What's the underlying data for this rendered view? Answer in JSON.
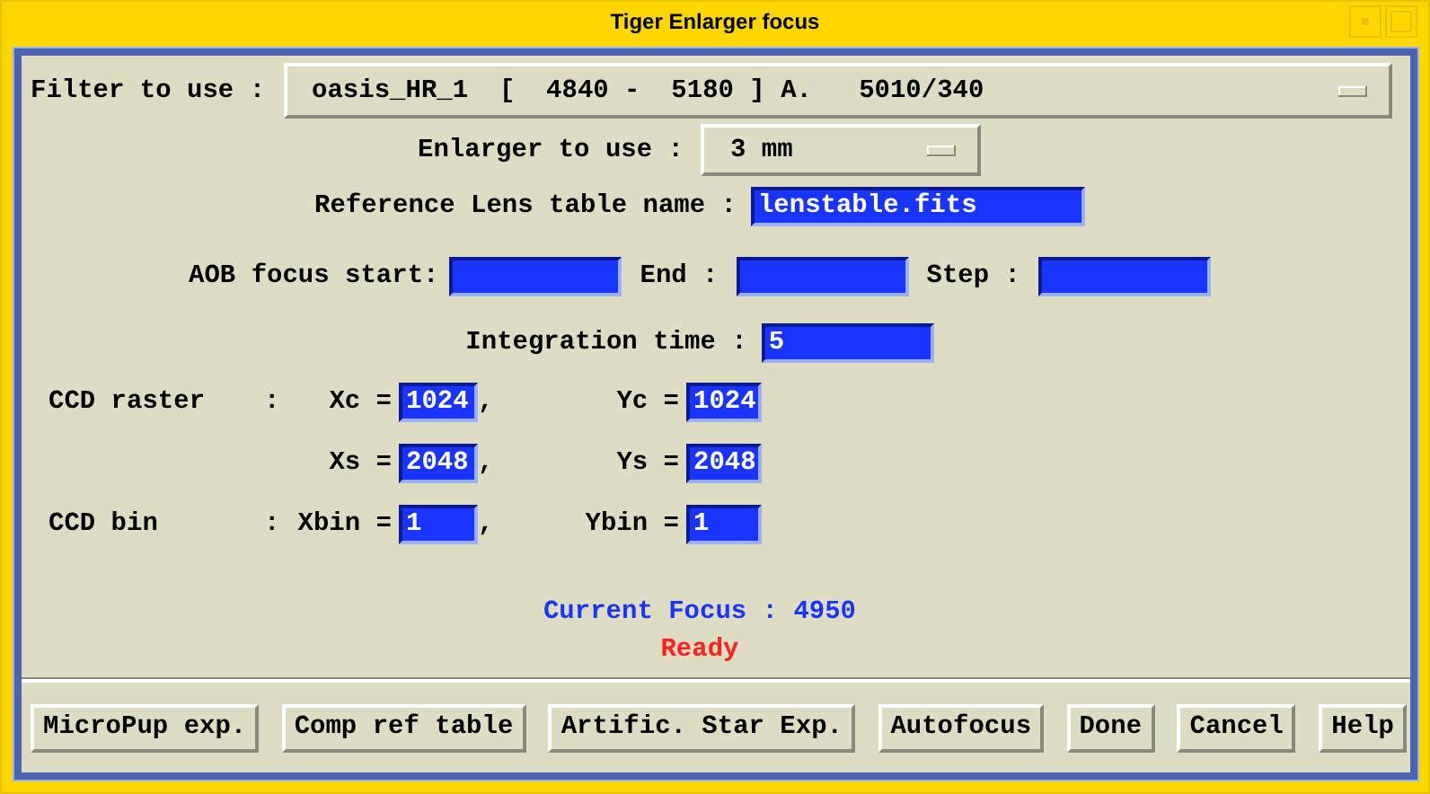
{
  "window": {
    "title": "Tiger Enlarger focus"
  },
  "filter": {
    "label": "Filter to use :",
    "value": "oasis_HR_1  [  4840 -  5180 ] A.   5010/340"
  },
  "enlarger": {
    "label": "Enlarger to use :",
    "value": "3 mm"
  },
  "lens_table": {
    "label": "Reference Lens table name :",
    "value": "lenstable.fits"
  },
  "aob_focus": [
    {
      "label": "AOB focus start:"
    },
    {
      "label": "End :"
    },
    {
      "label": "Step :"
    }
  ],
  "integration": {
    "label": "Integration time :",
    "value": "5"
  },
  "ccd_rows": [
    {
      "label": "CCD raster",
      "colon": ":",
      "x_label": "Xc =",
      "x_value": "1024",
      "comma": ",",
      "y_label": "Yc =",
      "y_value": "1024"
    },
    {
      "x_label": "Xs =",
      "x_value": "2048",
      "comma": ",",
      "y_label": "Ys =",
      "y_value": "2048"
    },
    {
      "label": "CCD bin",
      "colon": ":",
      "x_label": "Xbin =",
      "x_value": "1",
      "comma": ",",
      "y_label": "Ybin =",
      "y_value": "1"
    }
  ],
  "current_focus": "Current Focus : 4950",
  "status": "Ready",
  "buttons": [
    "MicroPup exp.",
    "Comp ref table",
    "Artific. Star Exp.",
    "Autofocus",
    "Done",
    "Cancel",
    "Help"
  ]
}
